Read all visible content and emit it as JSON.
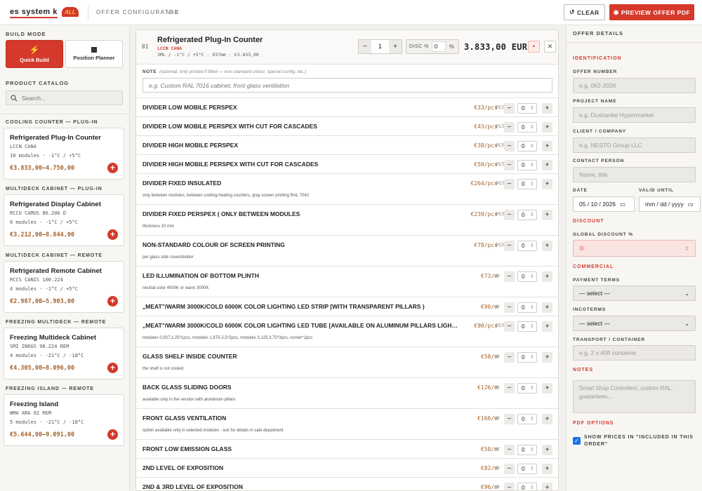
{
  "header": {
    "brand": "es system k",
    "logo_text": "ALL",
    "app_title": "OFFER CONFIGURATOR",
    "version": "v8.1",
    "clear_label": "CLEAR",
    "preview_label": "PREVIEW OFFER PDF",
    "accent": "#d4392b"
  },
  "left": {
    "build_mode_label": "BUILD MODE",
    "modes": [
      {
        "label": "Quick Build",
        "icon": "lightning-icon",
        "active": true
      },
      {
        "label": "Position Planner",
        "icon": "square-icon",
        "active": false
      }
    ],
    "catalog_label": "PRODUCT CATALOG",
    "search_placeholder": "Search...",
    "categories": [
      {
        "category": "COOLING COUNTER — PLUG-IN",
        "name": "Refrigerated Plug-In Counter",
        "code": "LCCN CANA",
        "specs": "10 modules · -1°C / +5°C",
        "price": "€3.833,00–4.750,00"
      },
      {
        "category": "MULTIDECK CABINET — PLUG-IN",
        "name": "Refrigerated Display Cabinet",
        "code": "RCCU CAMUS 86.206 D",
        "specs": "6 modules · -1°C / +5°C",
        "price": "€3.212,00–8.844,00"
      },
      {
        "category": "MULTIDECK CABINET — REMOTE",
        "name": "Refrigerated Remote Cabinet",
        "code": "RCCS CANIS 100.224",
        "specs": "4 modules · -1°C / +5°C",
        "price": "€2.987,00–5.903,00"
      },
      {
        "category": "FREEZING MULTIDECK — REMOTE",
        "name": "Freezing Multideck Cabinet",
        "code": "SMI INOUS 98.224 REM",
        "specs": "4 modules · -21°C / -18°C",
        "price": "€4.305,00–8.096,00"
      },
      {
        "category": "FREEZING ISLAND — REMOTE",
        "name": "Freezing Island",
        "code": "WMA ARA 02 REM",
        "specs": "5 modules · -21°C / -18°C",
        "price": "€5.644,00–9.091,00"
      }
    ]
  },
  "product": {
    "index": "01",
    "name": "Refrigerated Plug-In Counter",
    "code": "LCCN CANA",
    "meta": "3ML / -1°C / +5°C  ·  937mm  ·  €3.833,00",
    "qty": "1",
    "disc_label": "DISC %",
    "disc_value": "0",
    "disc_unit": "%",
    "total": "3.833,00 EUR",
    "note_label": "NOTE",
    "note_hint": "(optional, only printed if filled — non-standard colour, special config, etc.)",
    "note_placeholder": "e.g. Custom RAL 7016 cabinet, front glass ventilation",
    "options": [
      {
        "name": "DIVIDER LOW MOBILE PERSPEX",
        "desc": "",
        "price": "€33/pcs",
        "unit": "PCS",
        "qty": "0"
      },
      {
        "name": "DIVIDER LOW MOBILE PERSPEX WITH CUT FOR CASCADES",
        "desc": "",
        "price": "€43/pcs",
        "unit": "PCS",
        "qty": "0"
      },
      {
        "name": "DIVIDER HIGH MOBILE PERSPEX",
        "desc": "",
        "price": "€38/pcs",
        "unit": "PCS",
        "qty": "0"
      },
      {
        "name": "DIVIDER HIGH MOBILE PERSPEX WITH CUT FOR CASCADES",
        "desc": "",
        "price": "€50/pcs",
        "unit": "PCS",
        "qty": "0"
      },
      {
        "name": "DIVIDER FIXED INSULATED",
        "desc": "only between modules, between cooling-heating counters, gray screen printing RAL 7042",
        "price": "€264/pcs",
        "unit": "PCS",
        "qty": "0"
      },
      {
        "name": "DIVIDER FIXED PERSPEX ( ONLY BETWEEN MODULES",
        "desc": "thickness 10 mm",
        "price": "€239/pcs",
        "unit": "PCS",
        "qty": "0"
      },
      {
        "name": "NON-STANDARD COLOUR OF SCREEN PRINTING",
        "desc": "per glass side cover/divider",
        "price": "€78/pcs",
        "unit": "PCS",
        "qty": "0"
      },
      {
        "name": "LED ILLUMINATION OF BOTTOM PLINTH",
        "desc": "neutral color 4000K or warm 3000K",
        "price": "€73/m",
        "unit": "M",
        "qty": "0"
      },
      {
        "name": "„MEAT\"/WARM 3000K/COLD 6000K COLOR LIGHTING LED STRIP [WITH TRANSPARENT PILLARS )",
        "desc": "",
        "price": "€90/m",
        "unit": "M",
        "qty": "0"
      },
      {
        "name": "„MEAT\"/WARM 3000K/COLD 6000K COLOR LIGHTING LED TUBE [AVAILABLE ON ALUMINUM PILLARS LIGHTING]",
        "desc": "modules 0,937;1,25*1pcs, modules 1,875-2,5*2pcs, modules 3,125;3,75*3pcs, corner*1pcs",
        "price": "€90/pcs",
        "unit": "PCS",
        "qty": "0"
      },
      {
        "name": "GLASS SHELF INSIDE COUNTER",
        "desc": "the shelf is not cooled",
        "price": "€58/m",
        "unit": "M",
        "qty": "0"
      },
      {
        "name": "BACK GLASS SLIDING DOORS",
        "desc": "available only in the version with aluminium pillars",
        "price": "€126/m",
        "unit": "M",
        "qty": "0"
      },
      {
        "name": "FRONT GLASS VENTILATION",
        "desc": "option available only in selected modules - ask for details in sale depatment",
        "price": "€166/m",
        "unit": "M",
        "qty": "0"
      },
      {
        "name": "FRONT LOW EMISSION GLASS",
        "desc": "",
        "price": "€58/m",
        "unit": "M",
        "qty": "0"
      },
      {
        "name": "2ND LEVEL OF EXPOSITION",
        "desc": "",
        "price": "€82/m",
        "unit": "M",
        "qty": "0"
      },
      {
        "name": "2ND & 3RD LEVEL OF EXPOSITION",
        "desc": "",
        "price": "€96/m",
        "unit": "M",
        "qty": "0"
      }
    ]
  },
  "right": {
    "title": "OFFER DETAILS",
    "identification": "IDENTIFICATION",
    "offer_number_label": "OFFER NUMBER",
    "offer_number_ph": "e.g. 062-2026",
    "project_label": "PROJECT NAME",
    "project_ph": "e.g. Dushanbe Hypermarket",
    "client_label": "CLIENT / COMPANY",
    "client_ph": "e.g. NESTO Group LLC",
    "contact_label": "CONTACT PERSON",
    "contact_ph": "Name, title",
    "date_label": "DATE",
    "date_value": "05 / 10 / 2026",
    "valid_label": "VALID UNTIL",
    "valid_value": "mm / dd / yyyy",
    "discount_sec": "DISCOUNT",
    "global_disc_label": "GLOBAL DISCOUNT %",
    "global_disc_value": "0",
    "commercial_sec": "COMMERCIAL",
    "payment_label": "PAYMENT TERMS",
    "payment_value": "— select —",
    "incoterms_label": "INCOTERMS",
    "incoterms_value": "— select —",
    "transport_label": "TRANSPORT / CONTAINER",
    "transport_ph": "e.g. 2 x 40ft container",
    "notes_sec": "NOTES",
    "notes_ph": "Smart Shop Controllers, custom RAL, guarantees...",
    "pdf_sec": "PDF OPTIONS",
    "pdf_check_label": "SHOW PRICES IN \"INCLUDED IN THIS ORDER\"",
    "pdf_check": true
  }
}
